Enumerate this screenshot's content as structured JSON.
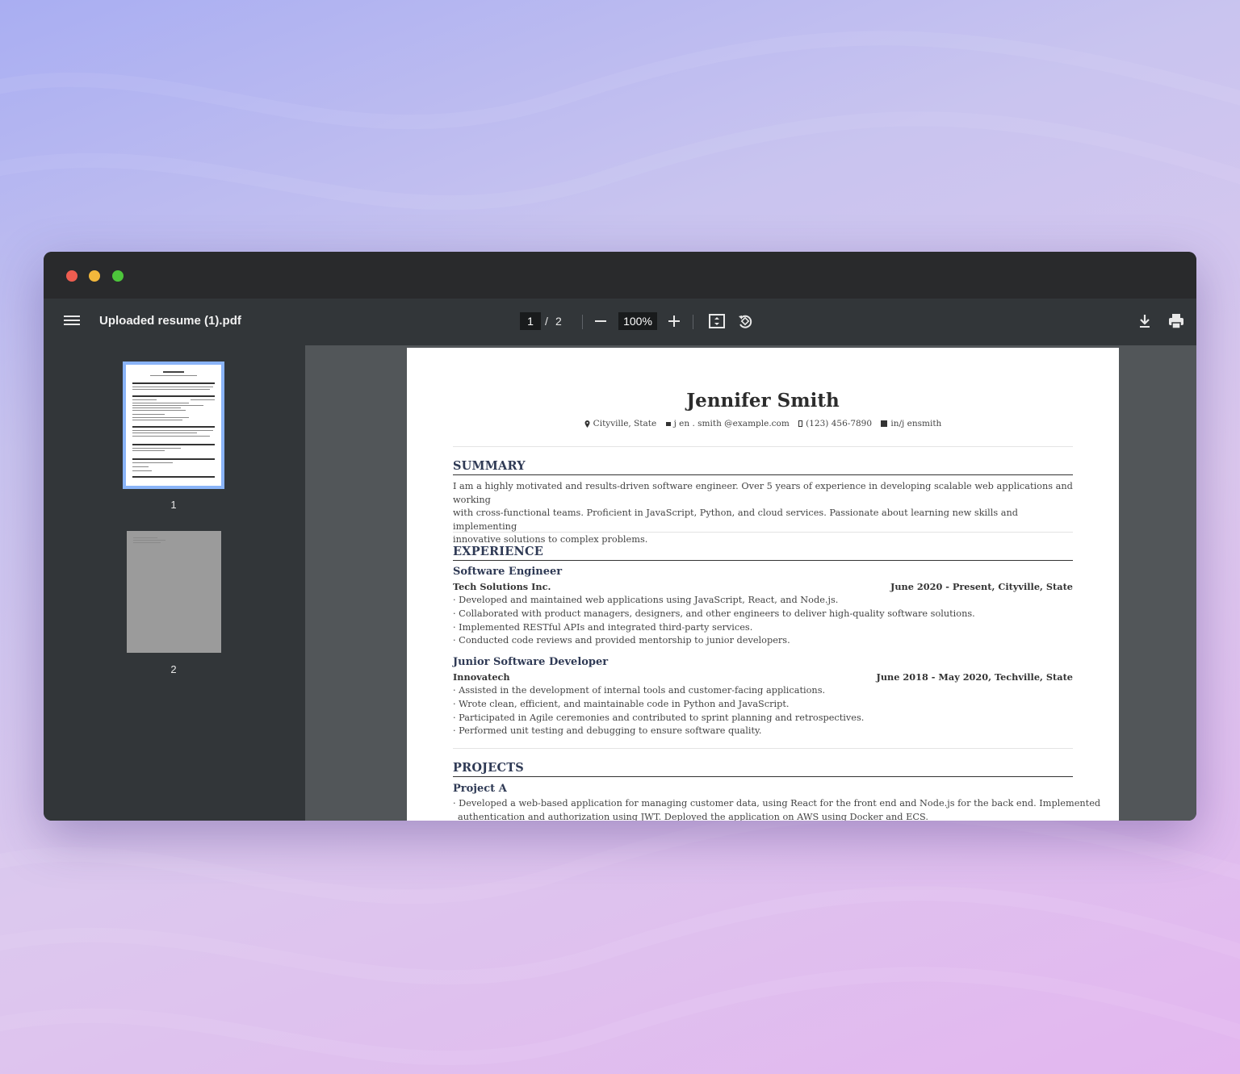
{
  "window": {
    "file_title": "Uploaded resume (1).pdf"
  },
  "toolbar": {
    "current_page": "1",
    "page_separator": "/",
    "total_pages": "2",
    "zoom": "100%"
  },
  "sidebar": {
    "thumbnails": [
      {
        "label": "1",
        "selected": true
      },
      {
        "label": "2",
        "selected": false
      }
    ]
  },
  "resume": {
    "name": "Jennifer Smith",
    "contact": {
      "location": "Cityville,  State",
      "email": "j en . smith @example.com",
      "phone": "(123) 456-7890",
      "linkedin": "in/j ensmith"
    },
    "summary": {
      "heading": "SUMMARY",
      "lines": [
        "I am a highly motivated and results-driven software engineer. Over 5 years of experience in developing scalable web applications and working",
        "with cross-functional teams. Proficient in JavaScript, Python, and cloud services. Passionate about learning new skills and implementing",
        "innovative solutions to complex problems."
      ]
    },
    "experience": {
      "heading": "EXPERIENCE",
      "jobs": [
        {
          "title": "Software Engineer",
          "company": "Tech Solutions Inc.",
          "dates": "June 2020 - Present,  Cityville, State",
          "bullets": [
            "· Developed and maintained web applications using JavaScript, React, and Node.js.",
            "· Collaborated with product managers, designers, and other engineers to deliver high-quality software solutions.",
            "· Implemented RESTful APIs and integrated third-party services.",
            "· Conducted code reviews and provided mentorship to junior developers."
          ]
        },
        {
          "title": "Junior Software Developer",
          "company": "Innovatech",
          "dates": "June 2018 - May 2020,  Techville, State",
          "bullets": [
            "· Assisted in the development of internal tools and customer-facing applications.",
            "· Wrote clean, efficient, and maintainable code in Python and JavaScript.",
            "· Participated in Agile ceremonies and contributed to sprint planning and retrospectives.",
            "· Performed unit testing and debugging to ensure software quality."
          ]
        }
      ]
    },
    "projects": {
      "heading": "PROJECTS",
      "items": [
        {
          "title": "Project A",
          "bullets": [
            "· Developed a web-based application for managing customer data, using React for the front end and Node.js for the back end. Implemented",
            "  authentication and authorization using JWT. Deployed the application on AWS using Docker and ECS."
          ]
        }
      ]
    }
  }
}
